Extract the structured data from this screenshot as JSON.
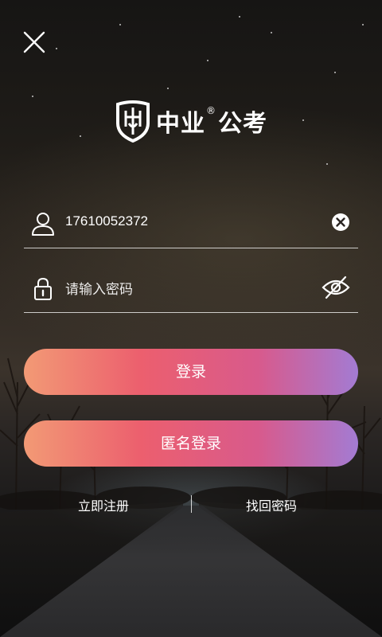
{
  "brand": {
    "name": "中业",
    "registered_mark": "®",
    "suffix": "公考"
  },
  "login_form": {
    "phone_value": "17610052372",
    "password_placeholder": "请输入密码"
  },
  "buttons": {
    "login": "登录",
    "anonymous_login": "匿名登录"
  },
  "links": {
    "register": "立即注册",
    "forgot_password": "找回密码"
  },
  "icons": {
    "close": "close-icon",
    "user": "user-icon",
    "clear": "clear-input-icon",
    "lock": "lock-icon",
    "visibility": "eye-off-icon",
    "logo": "shield-logo-icon"
  },
  "colors": {
    "button_gradient_start": "#f29a75",
    "button_gradient_mid": "#ec5f6e",
    "button_gradient_end": "#a37bd3"
  }
}
